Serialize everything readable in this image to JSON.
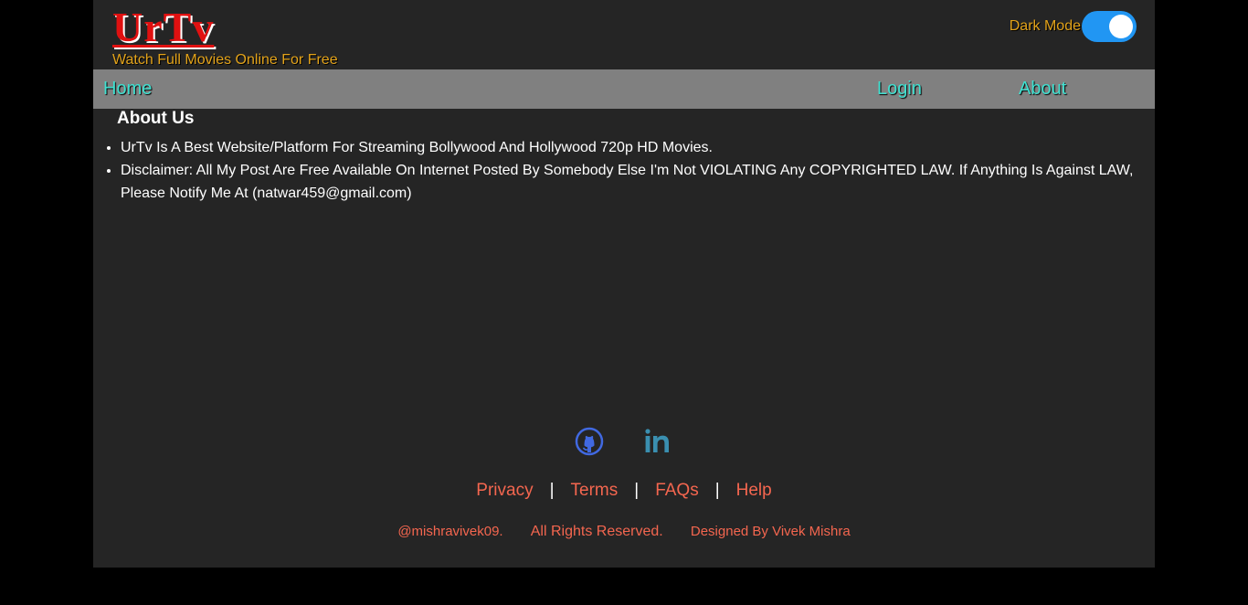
{
  "header": {
    "logo": "UrTv",
    "tagline": "Watch Full Movies Online For Free",
    "dark_mode_label": "Dark Mode",
    "dark_mode_on": true
  },
  "nav": {
    "home": "Home",
    "login": "Login",
    "about": "About"
  },
  "about": {
    "title": "About Us",
    "items": [
      "UrTv Is A Best Website/Platform For Streaming Bollywood And Hollywood 720p HD Movies.",
      "Disclaimer: All My Post Are Free Available On Internet Posted By Somebody Else I'm Not VIOLATING Any COPYRIGHTED LAW. If Anything Is Against LAW, Please Notify Me At (natwar459@gmail.com)"
    ]
  },
  "footer": {
    "social_icons": [
      "github-icon",
      "linkedin-icon"
    ],
    "links": [
      "Privacy",
      "Terms",
      "FAQs",
      "Help"
    ],
    "separator": "|",
    "handle": "@mishravivek09.",
    "rights": "All Rights Reserved.",
    "designer": "Designed By Vivek Mishra"
  },
  "colors": {
    "background": "#000000",
    "page": "#252525",
    "navbar": "#808080",
    "nav_link": "#40e0d0",
    "logo": "#e01010",
    "tagline": "#e3a31a",
    "toggle": "#2196f3",
    "footer_text": "#f4664f",
    "github": "#4169e1",
    "linkedin": "#3a8fb0"
  }
}
